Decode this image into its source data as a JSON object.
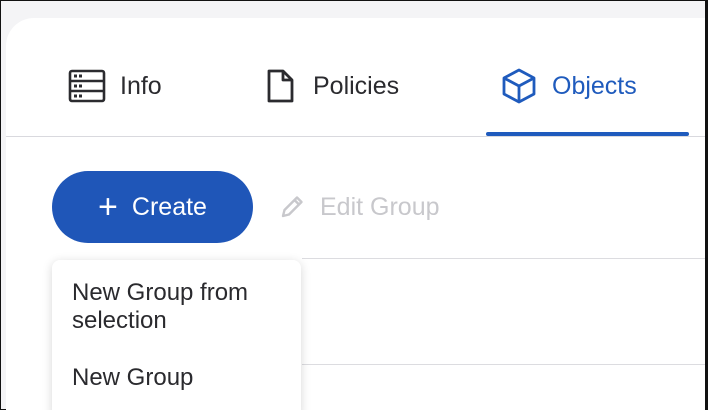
{
  "tabs": [
    {
      "label": "Info",
      "icon": "server-list-icon",
      "active": false
    },
    {
      "label": "Policies",
      "icon": "document-icon",
      "active": false
    },
    {
      "label": "Objects",
      "icon": "cube-icon",
      "active": true
    }
  ],
  "toolbar": {
    "create_label": "Create",
    "edit_group_label": "Edit Group"
  },
  "create_menu": {
    "items": [
      {
        "label": "New Group from selection"
      },
      {
        "label": "New Group"
      }
    ]
  },
  "colors": {
    "accent": "#1f56b8",
    "active_tab": "#1f5bbd",
    "disabled_text": "#c8c8cc"
  }
}
